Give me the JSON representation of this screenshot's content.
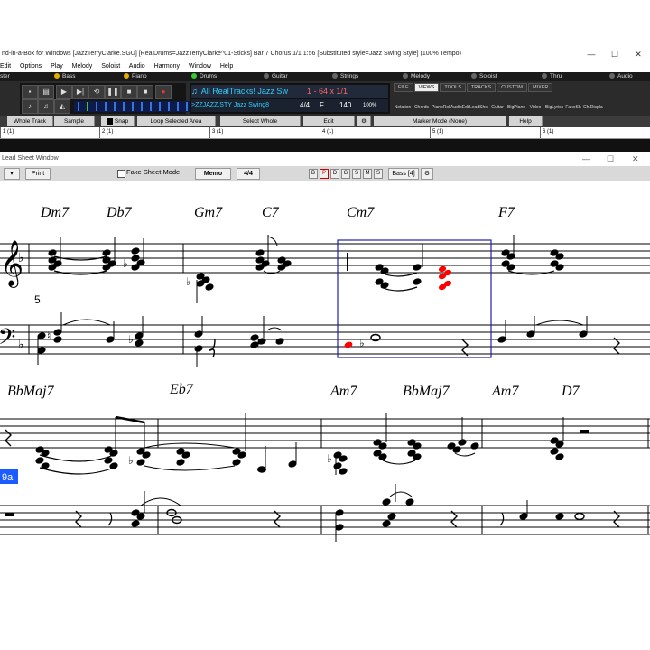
{
  "app": {
    "title": "nd-in-a-Box for Windows  [JazzTerryClarke.SGU]  [RealDrums=JazzTerryClarke^01-Sticks]  Bar 7 Chorus 1/1   1:56  [Substituted style=Jazz Swing Style] (100% Tempo)"
  },
  "menu": [
    "Edit",
    "Options",
    "Play",
    "Melody",
    "Soloist",
    "Audio",
    "Harmony",
    "Window",
    "Help"
  ],
  "tracks": [
    {
      "label": "ster",
      "color": "#888888"
    },
    {
      "label": "Bass",
      "color": "#e0b000"
    },
    {
      "label": "Piano",
      "color": "#e0b000"
    },
    {
      "label": "Drums",
      "color": "#33cc33"
    },
    {
      "label": "Guitar",
      "color": "#888888"
    },
    {
      "label": "Strings",
      "color": "#888888"
    },
    {
      "label": "Melody",
      "color": "#888888"
    },
    {
      "label": "Soloist",
      "color": "#888888"
    },
    {
      "label": "Thru",
      "color": "#888888"
    },
    {
      "label": "Audio",
      "color": "#888888"
    }
  ],
  "song": {
    "realtracks": "All RealTracks!  Jazz  Sw",
    "range": "1   -  64  x  1/1",
    "style": ">ZZJAZZ.STY Jazz Swing8",
    "timesig": "4/4",
    "key": "F",
    "tempo": "140",
    "tempo_pct": "100%"
  },
  "view_tabs": [
    "FILE",
    "VIEWS",
    "TOOLS",
    "TRACKS",
    "CUSTOM",
    "MIXER"
  ],
  "view_icons": [
    "Notation",
    "Chords",
    "PianoRoll",
    "AudioEdit",
    "LeadSheet",
    "Guitar",
    "BigPiano",
    "Video",
    "BigLyrics",
    "FakeSh",
    "Ch.Displa"
  ],
  "action_buttons": [
    "Whole Track",
    "Sample",
    "Snap",
    "Loop Selected Area",
    "Select Whole",
    "Edit",
    "Marker Mode (None)",
    "Help"
  ],
  "ruler": [
    "1 (1)",
    "2 (1)",
    "3 (1)",
    "4 (1)",
    "5 (1)",
    "6 (1)"
  ],
  "leadsheet": {
    "window_title": "Lead Sheet Window",
    "print": "Print",
    "fake_sheet": "Fake Sheet Mode",
    "memo": "Memo",
    "timesig": "4/4",
    "track_buttons": [
      "B",
      "P",
      "D",
      "G",
      "S",
      "M",
      "S"
    ],
    "bass_label": "Bass [4]"
  },
  "score": {
    "row1_chords": [
      "Dm7",
      "Db7",
      "Gm7",
      "C7",
      "Cm7",
      "F7"
    ],
    "row2_chords": [
      "BbMaj7",
      "Eb7",
      "Am7",
      "BbMaj7",
      "Am7",
      "D7"
    ],
    "bar_number": "5",
    "part_marker": "9a",
    "highlight_color": "#ff0000",
    "cursor_color": "#2222aa"
  }
}
